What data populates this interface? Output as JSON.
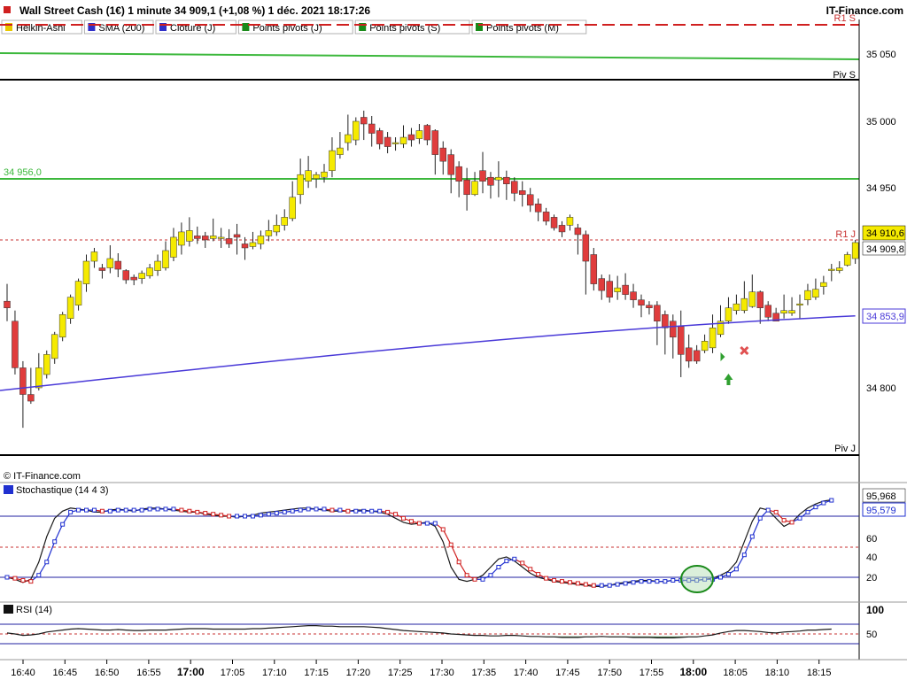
{
  "header": {
    "title": "Wall Street Cash (1€) 1 minute 34 909,1 (+1,08 %) 1 déc. 2021 18:17:26",
    "brand": "IT-Finance.com"
  },
  "legend": [
    {
      "label": "Heikin-Ashi",
      "color": "#e8c800"
    },
    {
      "label": "SMA (200)",
      "color": "#3030c8"
    },
    {
      "label": "Clôture (J)",
      "color": "#3030c8"
    },
    {
      "label": "Points pivots (J)",
      "color": "#1a8a1a"
    },
    {
      "label": "Points pivots (S)",
      "color": "#1a8a1a"
    },
    {
      "label": "Points pivots (M)",
      "color": "#1a8a1a"
    }
  ],
  "colors": {
    "bull": "#f5ea00",
    "bear": "#e03c3c",
    "sma": "#4a3ad8",
    "pivot_green": "#3cb83c",
    "dash_red": "#c83232",
    "stoch_k": "#1a1a1a",
    "stoch_d_up": "#2030d0",
    "stoch_d_down": "#d02020",
    "grid_blue": "#2020a0"
  },
  "main": {
    "pivot_labels": {
      "r1s": "R1 S",
      "pivs": "Piv S",
      "r1j": "R1 J",
      "pivj": "Piv J"
    },
    "level_label": "34 956,0",
    "price_badge": "34 910,6",
    "price_badge2": "34 909,8",
    "sma_badge": "34 853,9",
    "copyright": "© IT-Finance.com",
    "y_ticks": [
      "35 050",
      "35 000",
      "34 950",
      "34 800"
    ]
  },
  "stoch": {
    "label": "Stochastique (14 4 3)",
    "badge_top": "95,968",
    "badge_bottom": "95,579",
    "y_ticks": [
      "60",
      "40",
      "20"
    ]
  },
  "rsi": {
    "label": "RSI (14)",
    "y_ticks": [
      "100",
      "50"
    ]
  },
  "x_axis": {
    "ticks": [
      "16:40",
      "16:45",
      "16:50",
      "16:55",
      "17:00",
      "17:05",
      "17:10",
      "17:15",
      "17:20",
      "17:25",
      "17:30",
      "17:35",
      "17:40",
      "17:45",
      "17:50",
      "17:55",
      "18:00",
      "18:05",
      "18:10",
      "18:15"
    ],
    "bold": [
      "17:00",
      "18:00"
    ]
  },
  "chart_data": [
    {
      "type": "candlestick",
      "title": "Wall Street Cash (1€) 1 minute",
      "series_name": "Heikin-Ashi",
      "x_unit": "time",
      "ylim": [
        34760,
        35080
      ],
      "candles": [
        [
          34865,
          34860,
          34878,
          34850
        ],
        [
          34850,
          34815,
          34858,
          34810
        ],
        [
          34815,
          34795,
          34820,
          34770
        ],
        [
          34795,
          34790,
          34815,
          34788
        ],
        [
          34800,
          34815,
          34826,
          34798
        ],
        [
          34810,
          34825,
          34828,
          34807
        ],
        [
          34822,
          34840,
          34842,
          34818
        ],
        [
          34838,
          34855,
          34857,
          34835
        ],
        [
          34852,
          34868,
          34870,
          34848
        ],
        [
          34862,
          34880,
          34882,
          34858
        ],
        [
          34878,
          34895,
          34900,
          34872
        ],
        [
          34895,
          34902,
          34905,
          34890
        ],
        [
          34890,
          34888,
          34893,
          34882
        ],
        [
          34890,
          34897,
          34907,
          34886
        ],
        [
          34895,
          34889,
          34901,
          34883
        ],
        [
          34888,
          34881,
          34889,
          34878
        ],
        [
          34883,
          34881,
          34885,
          34877
        ],
        [
          34882,
          34886,
          34888,
          34878
        ],
        [
          34884,
          34890,
          34893,
          34882
        ],
        [
          34888,
          34895,
          34900,
          34884
        ],
        [
          34890,
          34903,
          34910,
          34888
        ],
        [
          34898,
          34913,
          34920,
          34895
        ],
        [
          34907,
          34917,
          34924,
          34900
        ],
        [
          34910,
          34918,
          34928,
          34906
        ],
        [
          34914,
          34912,
          34921,
          34908
        ],
        [
          34914,
          34911,
          34917,
          34905
        ],
        [
          34912,
          34914,
          34927,
          34910
        ],
        [
          34912,
          34913,
          34920,
          34905
        ],
        [
          34912,
          34908,
          34919,
          34905
        ],
        [
          34915,
          34913,
          34923,
          34900
        ],
        [
          34908,
          34905,
          34913,
          34896
        ],
        [
          34906,
          34909,
          34917,
          34904
        ],
        [
          34908,
          34914,
          34918,
          34904
        ],
        [
          34914,
          34918,
          34926,
          34910
        ],
        [
          34917,
          34922,
          34930,
          34914
        ],
        [
          34922,
          34928,
          34934,
          34918
        ],
        [
          34927,
          34943,
          34955,
          34925
        ],
        [
          34945,
          34960,
          34972,
          34938
        ],
        [
          34955,
          34963,
          34974,
          34950
        ],
        [
          34957,
          34960,
          34962,
          34950
        ],
        [
          34958,
          34962,
          34968,
          34954
        ],
        [
          34963,
          34978,
          34988,
          34958
        ],
        [
          34975,
          34980,
          34992,
          34972
        ],
        [
          34984,
          34990,
          35005,
          34978
        ],
        [
          34986,
          35000,
          35003,
          34982
        ],
        [
          35003,
          34998,
          35008,
          34986
        ],
        [
          34998,
          34991,
          35004,
          34981
        ],
        [
          34993,
          34983,
          34995,
          34979
        ],
        [
          34988,
          34981,
          34992,
          34976
        ],
        [
          34983,
          34984,
          34988,
          34978
        ],
        [
          34983,
          34988,
          34997,
          34980
        ],
        [
          34990,
          34986,
          34995,
          34981
        ],
        [
          34987,
          34993,
          34998,
          34983
        ],
        [
          34997,
          34986,
          34998,
          34982
        ],
        [
          34993,
          34975,
          34994,
          34960
        ],
        [
          34980,
          34970,
          34985,
          34960
        ],
        [
          34975,
          34960,
          34979,
          34946
        ],
        [
          34966,
          34955,
          34970,
          34943
        ],
        [
          34956,
          34945,
          34965,
          34933
        ],
        [
          34945,
          34955,
          34962,
          34944
        ],
        [
          34963,
          34955,
          34977,
          34946
        ],
        [
          34958,
          34952,
          34962,
          34942
        ],
        [
          34956,
          34958,
          34970,
          34943
        ],
        [
          34958,
          34953,
          34963,
          34941
        ],
        [
          34955,
          34946,
          34958,
          34940
        ],
        [
          34948,
          34945,
          34955,
          34936
        ],
        [
          34945,
          34937,
          34950,
          34932
        ],
        [
          34938,
          34932,
          34942,
          34925
        ],
        [
          34932,
          34925,
          34935,
          34922
        ],
        [
          34928,
          34920,
          34930,
          34918
        ],
        [
          34922,
          34917,
          34925,
          34913
        ],
        [
          34922,
          34928,
          34930,
          34918
        ],
        [
          34920,
          34915,
          34923,
          34900
        ],
        [
          34915,
          34895,
          34918,
          34870
        ],
        [
          34900,
          34878,
          34905,
          34873
        ],
        [
          34882,
          34873,
          34885,
          34866
        ],
        [
          34880,
          34868,
          34885,
          34864
        ],
        [
          34872,
          34875,
          34884,
          34866
        ],
        [
          34877,
          34870,
          34886,
          34866
        ],
        [
          34872,
          34866,
          34878,
          34860
        ],
        [
          34866,
          34862,
          34870,
          34853
        ],
        [
          34862,
          34860,
          34865,
          34855
        ],
        [
          34862,
          34850,
          34865,
          34832
        ],
        [
          34855,
          34845,
          34858,
          34825
        ],
        [
          34850,
          34838,
          34855,
          34822
        ],
        [
          34846,
          34825,
          34858,
          34808
        ],
        [
          34830,
          34820,
          34840,
          34815
        ],
        [
          34828,
          34820,
          34832,
          34818
        ],
        [
          34828,
          34835,
          34840,
          34826
        ],
        [
          34830,
          34845,
          34855,
          34826
        ],
        [
          34840,
          34850,
          34862,
          34838
        ],
        [
          34850,
          34860,
          34868,
          34848
        ],
        [
          34858,
          34863,
          34870,
          34855
        ],
        [
          34858,
          34867,
          34880,
          34856
        ],
        [
          34861,
          34872,
          34885,
          34860
        ],
        [
          34872,
          34860,
          34873,
          34848
        ],
        [
          34862,
          34853,
          34865,
          34850
        ],
        [
          34856,
          34850,
          34860,
          34850
        ],
        [
          34856,
          34858,
          34870,
          34852
        ],
        [
          34856,
          34858,
          34868,
          34854
        ],
        [
          34862,
          34863,
          34870,
          34852
        ],
        [
          34866,
          34873,
          34878,
          34862
        ],
        [
          34868,
          34874,
          34882,
          34866
        ],
        [
          34876,
          34879,
          34884,
          34870
        ],
        [
          34888,
          34889,
          34893,
          34880
        ],
        [
          34888,
          34890,
          34895,
          34886
        ],
        [
          34892,
          34900,
          34902,
          34891
        ],
        [
          34897,
          34909,
          34911,
          34893
        ]
      ],
      "sma200": {
        "start": 34798,
        "end": 34854
      },
      "levels": [
        {
          "name": "R1 S",
          "value": 35075
        },
        {
          "name": "Piv S",
          "value": 35027
        },
        {
          "name": "R1 J",
          "value": 34910.6
        },
        {
          "name": "Piv J",
          "value": 34760
        },
        {
          "name": "level",
          "value": 34956
        }
      ],
      "markers": [
        {
          "type": "buy-arrow",
          "index": 91
        },
        {
          "type": "sell-cross",
          "index": 93
        },
        {
          "type": "green-flag",
          "index": 90
        }
      ]
    },
    {
      "type": "line",
      "title": "Stochastique (14 4 3)",
      "ylim": [
        0,
        100
      ],
      "levels": [
        80,
        50,
        20
      ],
      "series": [
        {
          "name": "%K",
          "values": [
            20,
            18,
            15,
            18,
            35,
            60,
            78,
            85,
            88,
            87,
            86,
            84,
            84,
            86,
            87,
            86,
            85,
            87,
            88,
            88,
            87,
            86,
            85,
            84,
            84,
            82,
            81,
            80,
            80,
            79,
            80,
            81,
            83,
            84,
            85,
            86,
            87,
            88,
            88,
            87,
            86,
            85,
            85,
            85,
            86,
            86,
            85,
            84,
            82,
            78,
            74,
            72,
            73,
            74,
            70,
            55,
            30,
            18,
            16,
            18,
            22,
            30,
            38,
            40,
            36,
            30,
            24,
            20,
            18,
            16,
            15,
            14,
            13,
            12,
            11,
            11,
            12,
            14,
            15,
            16,
            17,
            17,
            16,
            16,
            17,
            17,
            17,
            17,
            18,
            19,
            22,
            26,
            35,
            55,
            75,
            88,
            86,
            78,
            70,
            74,
            82,
            88,
            92,
            95,
            96
          ]
        },
        {
          "name": "%D",
          "values": [
            20,
            19,
            17,
            16,
            22,
            35,
            55,
            72,
            84,
            86,
            86,
            86,
            85,
            85,
            86,
            86,
            86,
            86,
            87,
            87,
            87,
            87,
            86,
            85,
            84,
            83,
            82,
            81,
            80,
            80,
            80,
            80,
            81,
            82,
            83,
            84,
            85,
            86,
            87,
            87,
            87,
            86,
            86,
            85,
            85,
            85,
            85,
            85,
            84,
            82,
            78,
            75,
            73,
            73,
            73,
            67,
            52,
            35,
            22,
            18,
            18,
            22,
            30,
            36,
            38,
            34,
            28,
            23,
            19,
            17,
            16,
            15,
            14,
            13,
            12,
            12,
            12,
            13,
            14,
            15,
            16,
            16,
            16,
            16,
            17,
            17,
            17,
            17,
            18,
            18,
            20,
            23,
            28,
            42,
            60,
            78,
            86,
            84,
            76,
            74,
            78,
            84,
            89,
            93,
            95.6
          ]
        }
      ]
    },
    {
      "type": "line",
      "title": "RSI (14)",
      "ylim": [
        30,
        100
      ],
      "levels": [
        70,
        50,
        30
      ],
      "series": [
        {
          "name": "RSI",
          "values": [
            52,
            50,
            47,
            48,
            50,
            54,
            56,
            58,
            60,
            61,
            60,
            59,
            58,
            58,
            59,
            58,
            57,
            57,
            58,
            58,
            58,
            59,
            60,
            61,
            61,
            61,
            60,
            60,
            60,
            60,
            60,
            61,
            61,
            62,
            63,
            64,
            65,
            66,
            67,
            67,
            66,
            66,
            65,
            65,
            65,
            65,
            64,
            63,
            61,
            59,
            57,
            56,
            55,
            54,
            53,
            52,
            50,
            49,
            48,
            47,
            47,
            46,
            46,
            47,
            47,
            46,
            45,
            45,
            44,
            44,
            43,
            43,
            43,
            44,
            44,
            45,
            44,
            44,
            44,
            43,
            43,
            43,
            42,
            42,
            42,
            43,
            44,
            44,
            46,
            48,
            52,
            55,
            57,
            57,
            56,
            55,
            53,
            52,
            54,
            55,
            56,
            58,
            58,
            59,
            60
          ]
        }
      ]
    }
  ]
}
